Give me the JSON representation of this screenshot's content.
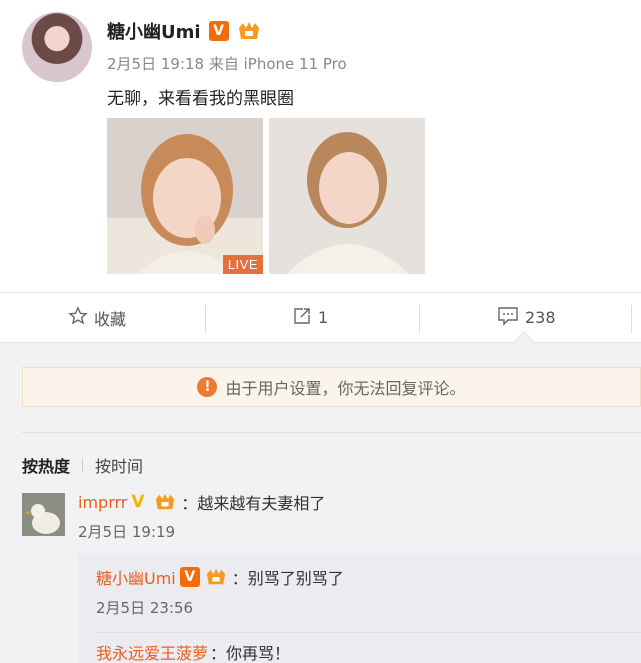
{
  "post": {
    "author": "糖小幽Umi",
    "vip_badge": "V",
    "meta": "2月5日 19:18 来自 iPhone 11 Pro",
    "text": "无聊，来看看我的黑眼圈",
    "live_badge": "LIVE"
  },
  "actions": {
    "favorite_label": "收藏",
    "share_count": "1",
    "comment_count": "238"
  },
  "comments_panel": {
    "notice": "由于用户设置，你无法回复评论。",
    "notice_icon": "!",
    "sort_hot": "按热度",
    "sort_time": "按时间"
  },
  "comment": {
    "user": "imprrr",
    "vip_badge": "V",
    "text": "：越来越有夫妻相了",
    "time": "2月5日 19:19"
  },
  "replies": [
    {
      "user": "糖小幽Umi",
      "vip_badge": "V",
      "text": "：别骂了别骂了",
      "time": "2月5日 23:56"
    },
    {
      "user": "我永远爱王菠萝",
      "text": "：你再骂！"
    }
  ],
  "colors": {
    "accent_orange": "#e8601c",
    "vip_orange": "#f26d0a",
    "notice_bg": "#fbf4ea",
    "panel_bg": "#f2f2f5"
  }
}
